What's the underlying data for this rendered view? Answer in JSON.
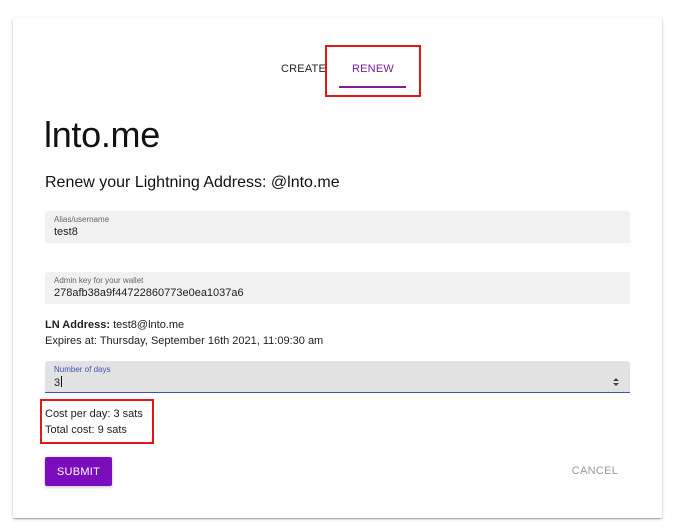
{
  "tabs": [
    {
      "label": "CREATE",
      "active": false
    },
    {
      "label": "RENEW",
      "active": true
    }
  ],
  "header": {
    "title": "lnto.me",
    "subtitle": "Renew your Lightning Address: @lnto.me"
  },
  "form": {
    "alias": {
      "label": "Alias/username",
      "value": "test8"
    },
    "admin_key": {
      "label": "Admin key for your wallet",
      "value": "278afb38a9f44722860773e0ea1037a6"
    },
    "days": {
      "label": "Number of days",
      "value": "3"
    }
  },
  "info": {
    "ln_address_label": "LN Address:",
    "ln_address_value": "test8@lnto.me",
    "expires": "Expires at: Thursday, September 16th 2021, 11:09:30 am"
  },
  "cost": {
    "per_day": "Cost per day: 3 sats",
    "total": "Total cost: 9 sats"
  },
  "actions": {
    "submit_label": "SUBMIT",
    "cancel_label": "CANCEL"
  },
  "colors": {
    "accent": "#7b1fa2",
    "submit_bg": "#7b0dbf",
    "focus_underline": "#3f51b5",
    "highlight_box": "#e01818"
  }
}
